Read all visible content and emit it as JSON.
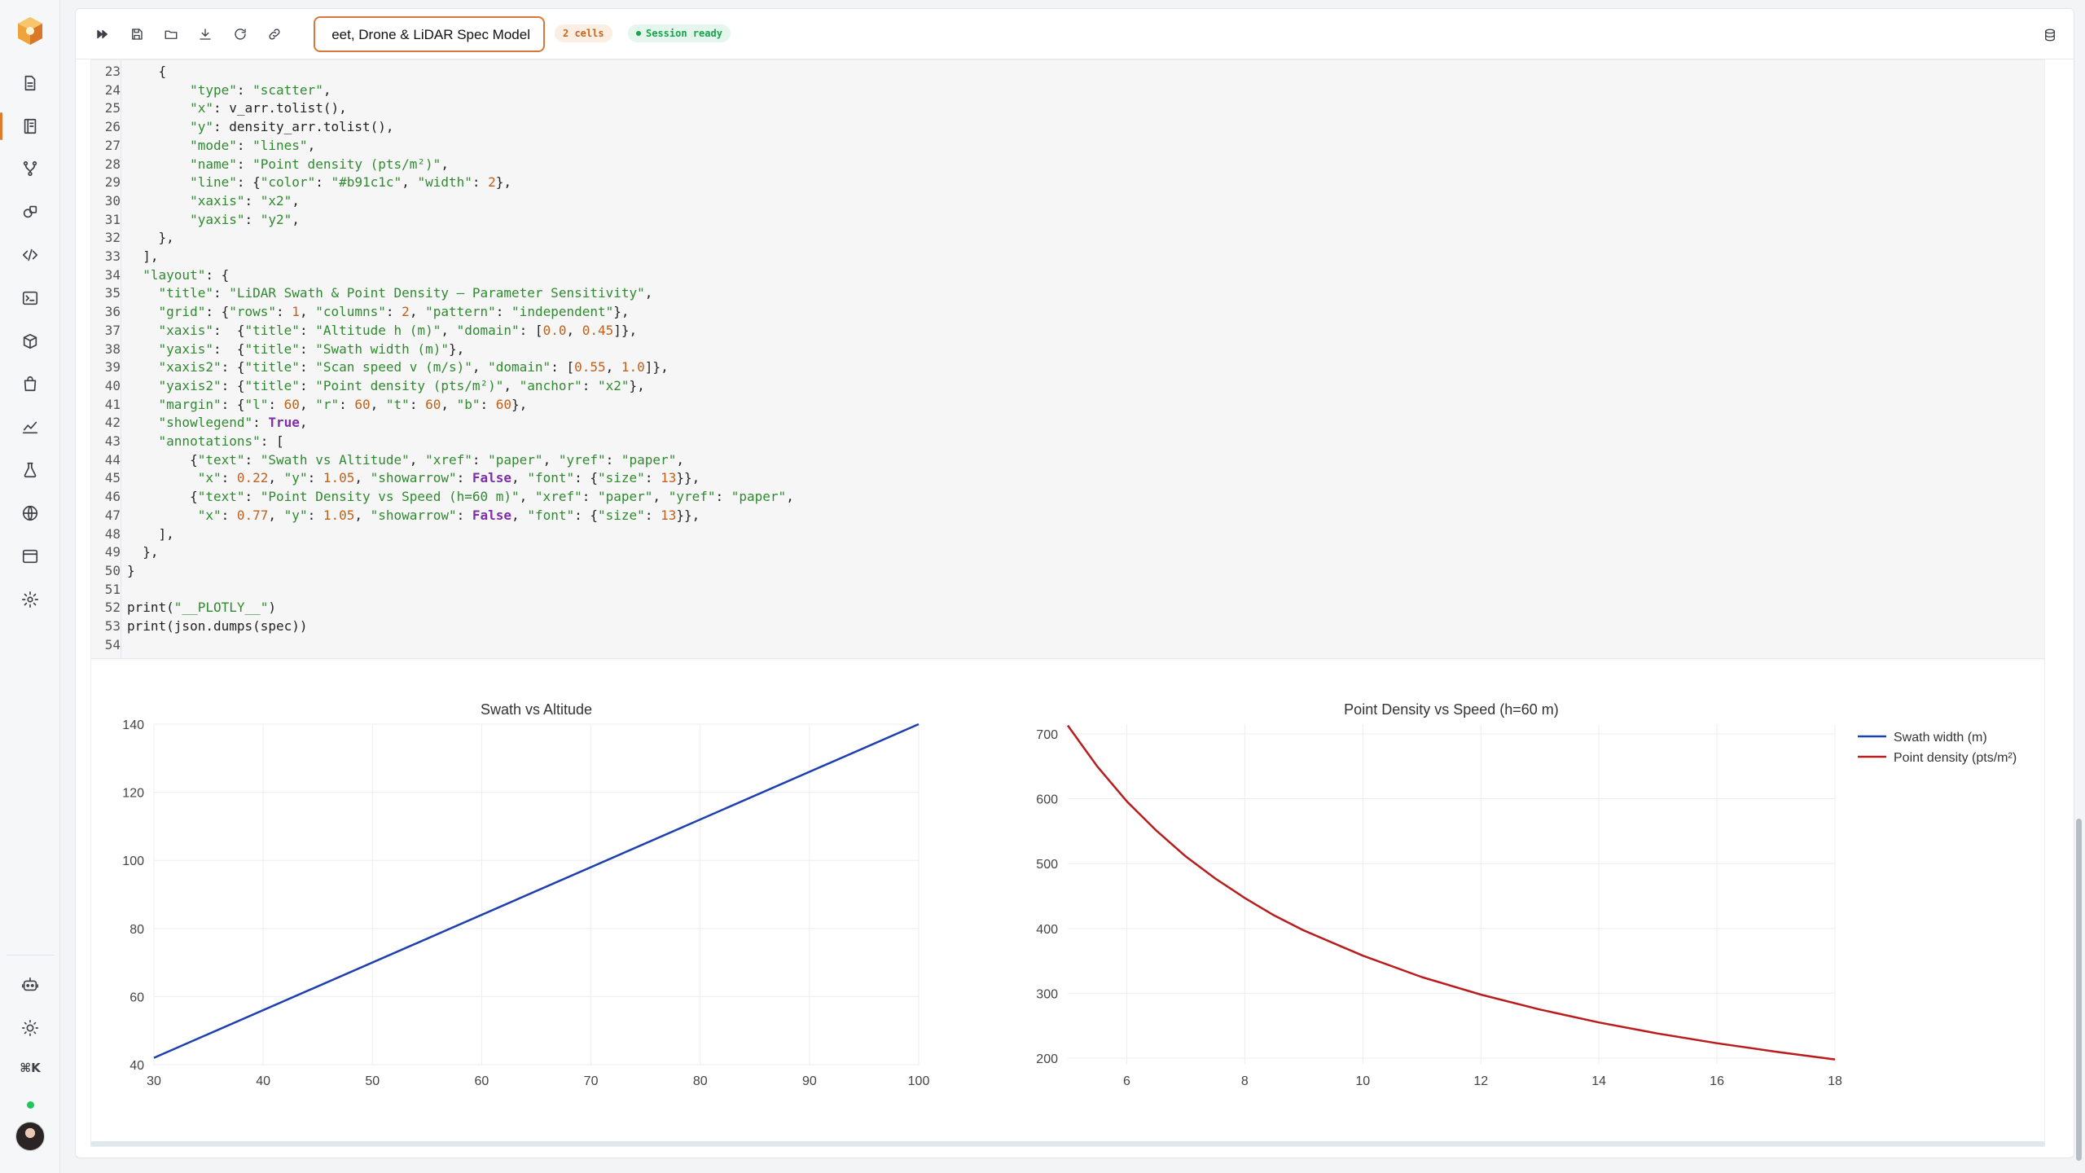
{
  "toolbar": {
    "title_value": "eet, Drone & LiDAR Spec Model",
    "cells_badge": "2 cells",
    "session_badge": "Session ready",
    "buttons": [
      "run-all-icon",
      "save-icon",
      "open-folder-icon",
      "download-icon",
      "refresh-icon",
      "link-icon"
    ]
  },
  "rail": {
    "icons": [
      "file-icon",
      "notebook-icon",
      "branch-icon",
      "shapes-icon",
      "code-icon",
      "terminal-icon",
      "cube-icon",
      "bag-icon",
      "chart-icon",
      "flask-icon",
      "globe-icon",
      "window-icon",
      "gear-icon",
      "bot-icon",
      "sun-icon"
    ],
    "shortcut": "⌘K"
  },
  "code": {
    "lines": [
      {
        "n": "23",
        "html": "    {"
      },
      {
        "n": "24",
        "html": "        <span class=\"s\">\"type\"</span>: <span class=\"s\">\"scatter\"</span>,"
      },
      {
        "n": "25",
        "html": "        <span class=\"s\">\"x\"</span>: v_arr.tolist(),"
      },
      {
        "n": "26",
        "html": "        <span class=\"s\">\"y\"</span>: density_arr.tolist(),"
      },
      {
        "n": "27",
        "html": "        <span class=\"s\">\"mode\"</span>: <span class=\"s\">\"lines\"</span>,"
      },
      {
        "n": "28",
        "html": "        <span class=\"s\">\"name\"</span>: <span class=\"s\">\"Point density (pts/m²)\"</span>,"
      },
      {
        "n": "29",
        "html": "        <span class=\"s\">\"line\"</span>: {<span class=\"s\">\"color\"</span>: <span class=\"s\">\"#b91c1c\"</span>, <span class=\"s\">\"width\"</span>: <span class=\"n\">2</span>},"
      },
      {
        "n": "30",
        "html": "        <span class=\"s\">\"xaxis\"</span>: <span class=\"s\">\"x2\"</span>,"
      },
      {
        "n": "31",
        "html": "        <span class=\"s\">\"yaxis\"</span>: <span class=\"s\">\"y2\"</span>,"
      },
      {
        "n": "32",
        "html": "    },"
      },
      {
        "n": "33",
        "html": "  ],"
      },
      {
        "n": "34",
        "html": "  <span class=\"s\">\"layout\"</span>: {"
      },
      {
        "n": "35",
        "html": "    <span class=\"s\">\"title\"</span>: <span class=\"s\">\"LiDAR Swath &amp; Point Density — Parameter Sensitivity\"</span>,"
      },
      {
        "n": "36",
        "html": "    <span class=\"s\">\"grid\"</span>: {<span class=\"s\">\"rows\"</span>: <span class=\"n\">1</span>, <span class=\"s\">\"columns\"</span>: <span class=\"n\">2</span>, <span class=\"s\">\"pattern\"</span>: <span class=\"s\">\"independent\"</span>},"
      },
      {
        "n": "37",
        "html": "    <span class=\"s\">\"xaxis\"</span>:  {<span class=\"s\">\"title\"</span>: <span class=\"s\">\"Altitude h (m)\"</span>, <span class=\"s\">\"domain\"</span>: [<span class=\"n\">0.0</span>, <span class=\"n\">0.45</span>]},"
      },
      {
        "n": "38",
        "html": "    <span class=\"s\">\"yaxis\"</span>:  {<span class=\"s\">\"title\"</span>: <span class=\"s\">\"Swath width (m)\"</span>},"
      },
      {
        "n": "39",
        "html": "    <span class=\"s\">\"xaxis2\"</span>: {<span class=\"s\">\"title\"</span>: <span class=\"s\">\"Scan speed v (m/s)\"</span>, <span class=\"s\">\"domain\"</span>: [<span class=\"n\">0.55</span>, <span class=\"n\">1.0</span>]},"
      },
      {
        "n": "40",
        "html": "    <span class=\"s\">\"yaxis2\"</span>: {<span class=\"s\">\"title\"</span>: <span class=\"s\">\"Point density (pts/m²)\"</span>, <span class=\"s\">\"anchor\"</span>: <span class=\"s\">\"x2\"</span>},"
      },
      {
        "n": "41",
        "html": "    <span class=\"s\">\"margin\"</span>: {<span class=\"s\">\"l\"</span>: <span class=\"n\">60</span>, <span class=\"s\">\"r\"</span>: <span class=\"n\">60</span>, <span class=\"s\">\"t\"</span>: <span class=\"n\">60</span>, <span class=\"s\">\"b\"</span>: <span class=\"n\">60</span>},"
      },
      {
        "n": "42",
        "html": "    <span class=\"s\">\"showlegend\"</span>: <span class=\"k\">True</span>,"
      },
      {
        "n": "43",
        "html": "    <span class=\"s\">\"annotations\"</span>: ["
      },
      {
        "n": "44",
        "html": "        {<span class=\"s\">\"text\"</span>: <span class=\"s\">\"Swath vs Altitude\"</span>, <span class=\"s\">\"xref\"</span>: <span class=\"s\">\"paper\"</span>, <span class=\"s\">\"yref\"</span>: <span class=\"s\">\"paper\"</span>,"
      },
      {
        "n": "45",
        "html": "         <span class=\"s\">\"x\"</span>: <span class=\"n\">0.22</span>, <span class=\"s\">\"y\"</span>: <span class=\"n\">1.05</span>, <span class=\"s\">\"showarrow\"</span>: <span class=\"k\">False</span>, <span class=\"s\">\"font\"</span>: {<span class=\"s\">\"size\"</span>: <span class=\"n\">13</span>}},"
      },
      {
        "n": "46",
        "html": "        {<span class=\"s\">\"text\"</span>: <span class=\"s\">\"Point Density vs Speed (h=60 m)\"</span>, <span class=\"s\">\"xref\"</span>: <span class=\"s\">\"paper\"</span>, <span class=\"s\">\"yref\"</span>: <span class=\"s\">\"paper\"</span>,"
      },
      {
        "n": "47",
        "html": "         <span class=\"s\">\"x\"</span>: <span class=\"n\">0.77</span>, <span class=\"s\">\"y\"</span>: <span class=\"n\">1.05</span>, <span class=\"s\">\"showarrow\"</span>: <span class=\"k\">False</span>, <span class=\"s\">\"font\"</span>: {<span class=\"s\">\"size\"</span>: <span class=\"n\">13</span>}},"
      },
      {
        "n": "48",
        "html": "    ],"
      },
      {
        "n": "49",
        "html": "  },"
      },
      {
        "n": "50",
        "html": "}"
      },
      {
        "n": "51",
        "html": ""
      },
      {
        "n": "52",
        "html": "print(<span class=\"s\">\"__PLOTLY__\"</span>)"
      },
      {
        "n": "53",
        "html": "print(json.dumps(spec))"
      },
      {
        "n": "54",
        "html": ""
      }
    ]
  },
  "chart_data": [
    {
      "type": "line",
      "title": "Swath vs Altitude",
      "xlabel": "",
      "ylabel": "",
      "xlim": [
        30,
        100
      ],
      "ylim": [
        40,
        140
      ],
      "x_ticks": [
        30,
        40,
        50,
        60,
        70,
        80,
        90,
        100
      ],
      "y_ticks": [
        40,
        60,
        80,
        100,
        120,
        140
      ],
      "grid": true,
      "series": [
        {
          "name": "Swath width (m)",
          "color": "#1e40af",
          "x": [
            30,
            100
          ],
          "y": [
            42,
            140
          ]
        }
      ]
    },
    {
      "type": "line",
      "title": "Point Density vs Speed (h=60 m)",
      "xlabel": "",
      "ylabel": "",
      "xlim": [
        5,
        18
      ],
      "ylim": [
        190,
        715
      ],
      "x_ticks": [
        6,
        8,
        10,
        12,
        14,
        16,
        18
      ],
      "y_ticks": [
        200,
        300,
        400,
        500,
        600,
        700
      ],
      "grid": true,
      "legend": "top-right",
      "series": [
        {
          "name": "Point density (pts/m²)",
          "color": "#b91c1c",
          "x": [
            5,
            5.5,
            6,
            6.5,
            7,
            7.5,
            8,
            8.5,
            9,
            10,
            11,
            12,
            13,
            14,
            15,
            16,
            17,
            18
          ],
          "y": [
            713,
            650,
            596,
            551,
            511,
            477,
            447,
            420,
            397,
            358,
            325,
            298,
            275,
            255,
            238,
            223,
            210,
            198
          ]
        }
      ]
    }
  ]
}
